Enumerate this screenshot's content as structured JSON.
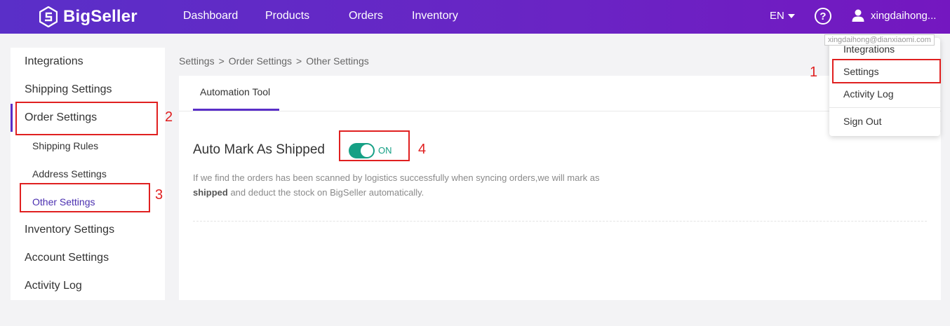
{
  "brand": {
    "name": "BigSeller"
  },
  "nav": {
    "dashboard": "Dashboard",
    "products": "Products",
    "orders": "Orders",
    "inventory": "Inventory"
  },
  "header": {
    "language": "EN",
    "help": "?",
    "username": "xingdaihong...",
    "email_tooltip": "xingdaihong@dianxiaomi.com"
  },
  "user_menu": {
    "integrations": "Integrations",
    "settings": "Settings",
    "activity_log": "Activity Log",
    "sign_out": "Sign Out"
  },
  "sidebar": {
    "integrations": "Integrations",
    "shipping_settings": "Shipping Settings",
    "order_settings": "Order Settings",
    "shipping_rules": "Shipping Rules",
    "address_settings": "Address Settings",
    "other_settings": "Other Settings",
    "inventory_settings": "Inventory Settings",
    "account_settings": "Account Settings",
    "activity_log": "Activity Log"
  },
  "breadcrumb": {
    "level1": "Settings",
    "sep1": ">",
    "level2": "Order Settings",
    "sep2": ">",
    "level3": "Other Settings"
  },
  "main": {
    "tab": "Automation Tool",
    "setting_title": "Auto Mark As Shipped",
    "toggle_state": "ON",
    "desc_part1": "If we find the orders has been scanned by logistics successfully when syncing orders,we will mark as ",
    "desc_bold": "shipped",
    "desc_part2": " and deduct the stock on BigSeller automatically."
  },
  "annotations": {
    "n1": "1",
    "n2": "2",
    "n3": "3",
    "n4": "4"
  },
  "colors": {
    "header_start": "#5a2fc8",
    "header_end": "#7417c0",
    "toggle_on": "#16a085",
    "annotation_red": "#e02020",
    "active_purple": "#5a2fc8"
  },
  "icons": {
    "logo": "bigseller-logo-icon",
    "help": "help-circle-icon",
    "user": "user-icon",
    "caret": "caret-down-icon"
  }
}
